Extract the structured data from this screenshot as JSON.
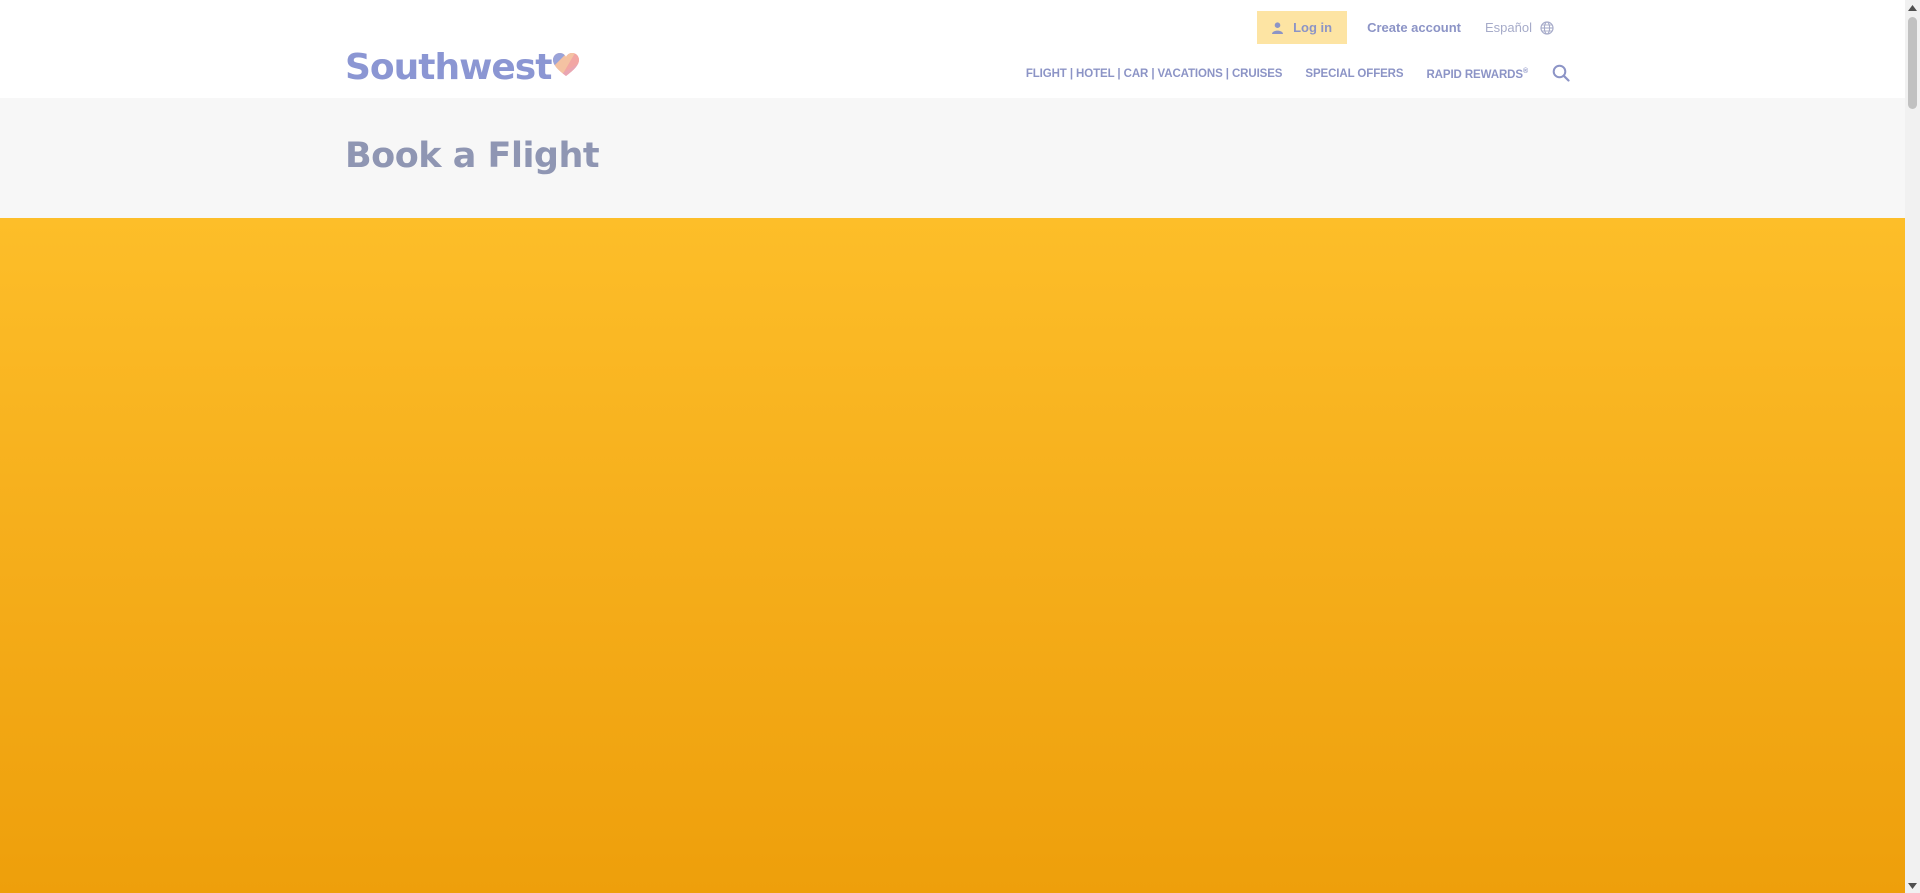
{
  "header": {
    "login_label": "Log in",
    "create_account_label": "Create account",
    "language_label": "Español",
    "logo_text": "Southwest",
    "logo_mark": "®",
    "nav": {
      "booking_label": "FLIGHT | HOTEL | CAR | VACATIONS | CRUISES",
      "special_offers_label": "SPECIAL OFFERS",
      "rapid_rewards_label": "RAPID REWARDS",
      "rapid_rewards_mark": "®"
    },
    "icons": {
      "login": "user-icon",
      "language": "globe-icon",
      "search": "search-icon",
      "logo": "heart-icon"
    }
  },
  "page": {
    "title": "Book a Flight"
  },
  "colors": {
    "accent_blue": "#8c94c6",
    "login_bg": "#fde4a3",
    "title_band": "#f7f7f7",
    "hero_top": "#fdbe29",
    "hero_bottom": "#ee9f0b"
  }
}
